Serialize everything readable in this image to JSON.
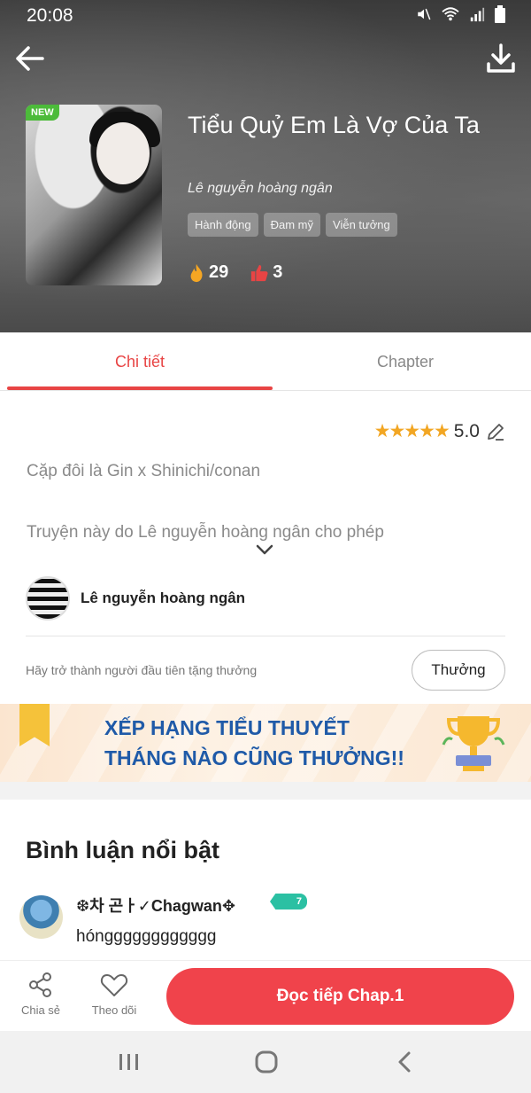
{
  "status_bar": {
    "time": "20:08"
  },
  "header": {
    "badge": "NEW"
  },
  "story": {
    "title": "Tiểu Quỷ Em Là Vợ Của Ta",
    "author": "Lê nguyễn hoàng ngân",
    "tags": [
      "Hành động",
      "Đam mỹ",
      "Viễn tưởng"
    ],
    "fire_count": "29",
    "like_count": "3"
  },
  "tabs": [
    {
      "label": "Chi tiết",
      "active": true
    },
    {
      "label": "Chapter",
      "active": false
    }
  ],
  "details": {
    "rating_value": "5.0",
    "stars": 5,
    "description_line1": "Cặp đôi là Gin x Shinichi/conan",
    "description_line2": "Truyện này do Lê nguyễn hoàng ngân cho phép",
    "uploader_name": "Lê nguyễn hoàng ngân",
    "reward_prompt": "Hãy trở thành người đầu tiên tặng thưởng",
    "reward_button": "Thưởng"
  },
  "banner": {
    "line1": "XẾP HẠNG TIỂU THUYẾT",
    "line2": "THÁNG NÀO CŨNG THƯỞNG!!"
  },
  "comments": {
    "title": "Bình luận nổi bật",
    "items": [
      {
        "user": "❆차 곤ㅏ✓Chagwan✥",
        "badge": "7",
        "text": "hóngggggggggggg"
      }
    ]
  },
  "action_bar": {
    "share_label": "Chia sẻ",
    "follow_label": "Theo dõi",
    "read_button": "Đọc tiếp Chap.1"
  },
  "colors": {
    "accent": "#e84444",
    "read_button": "#f0434b",
    "star": "#f2a623",
    "new_badge": "#4cbb3a",
    "banner_text": "#1f5aa8"
  }
}
